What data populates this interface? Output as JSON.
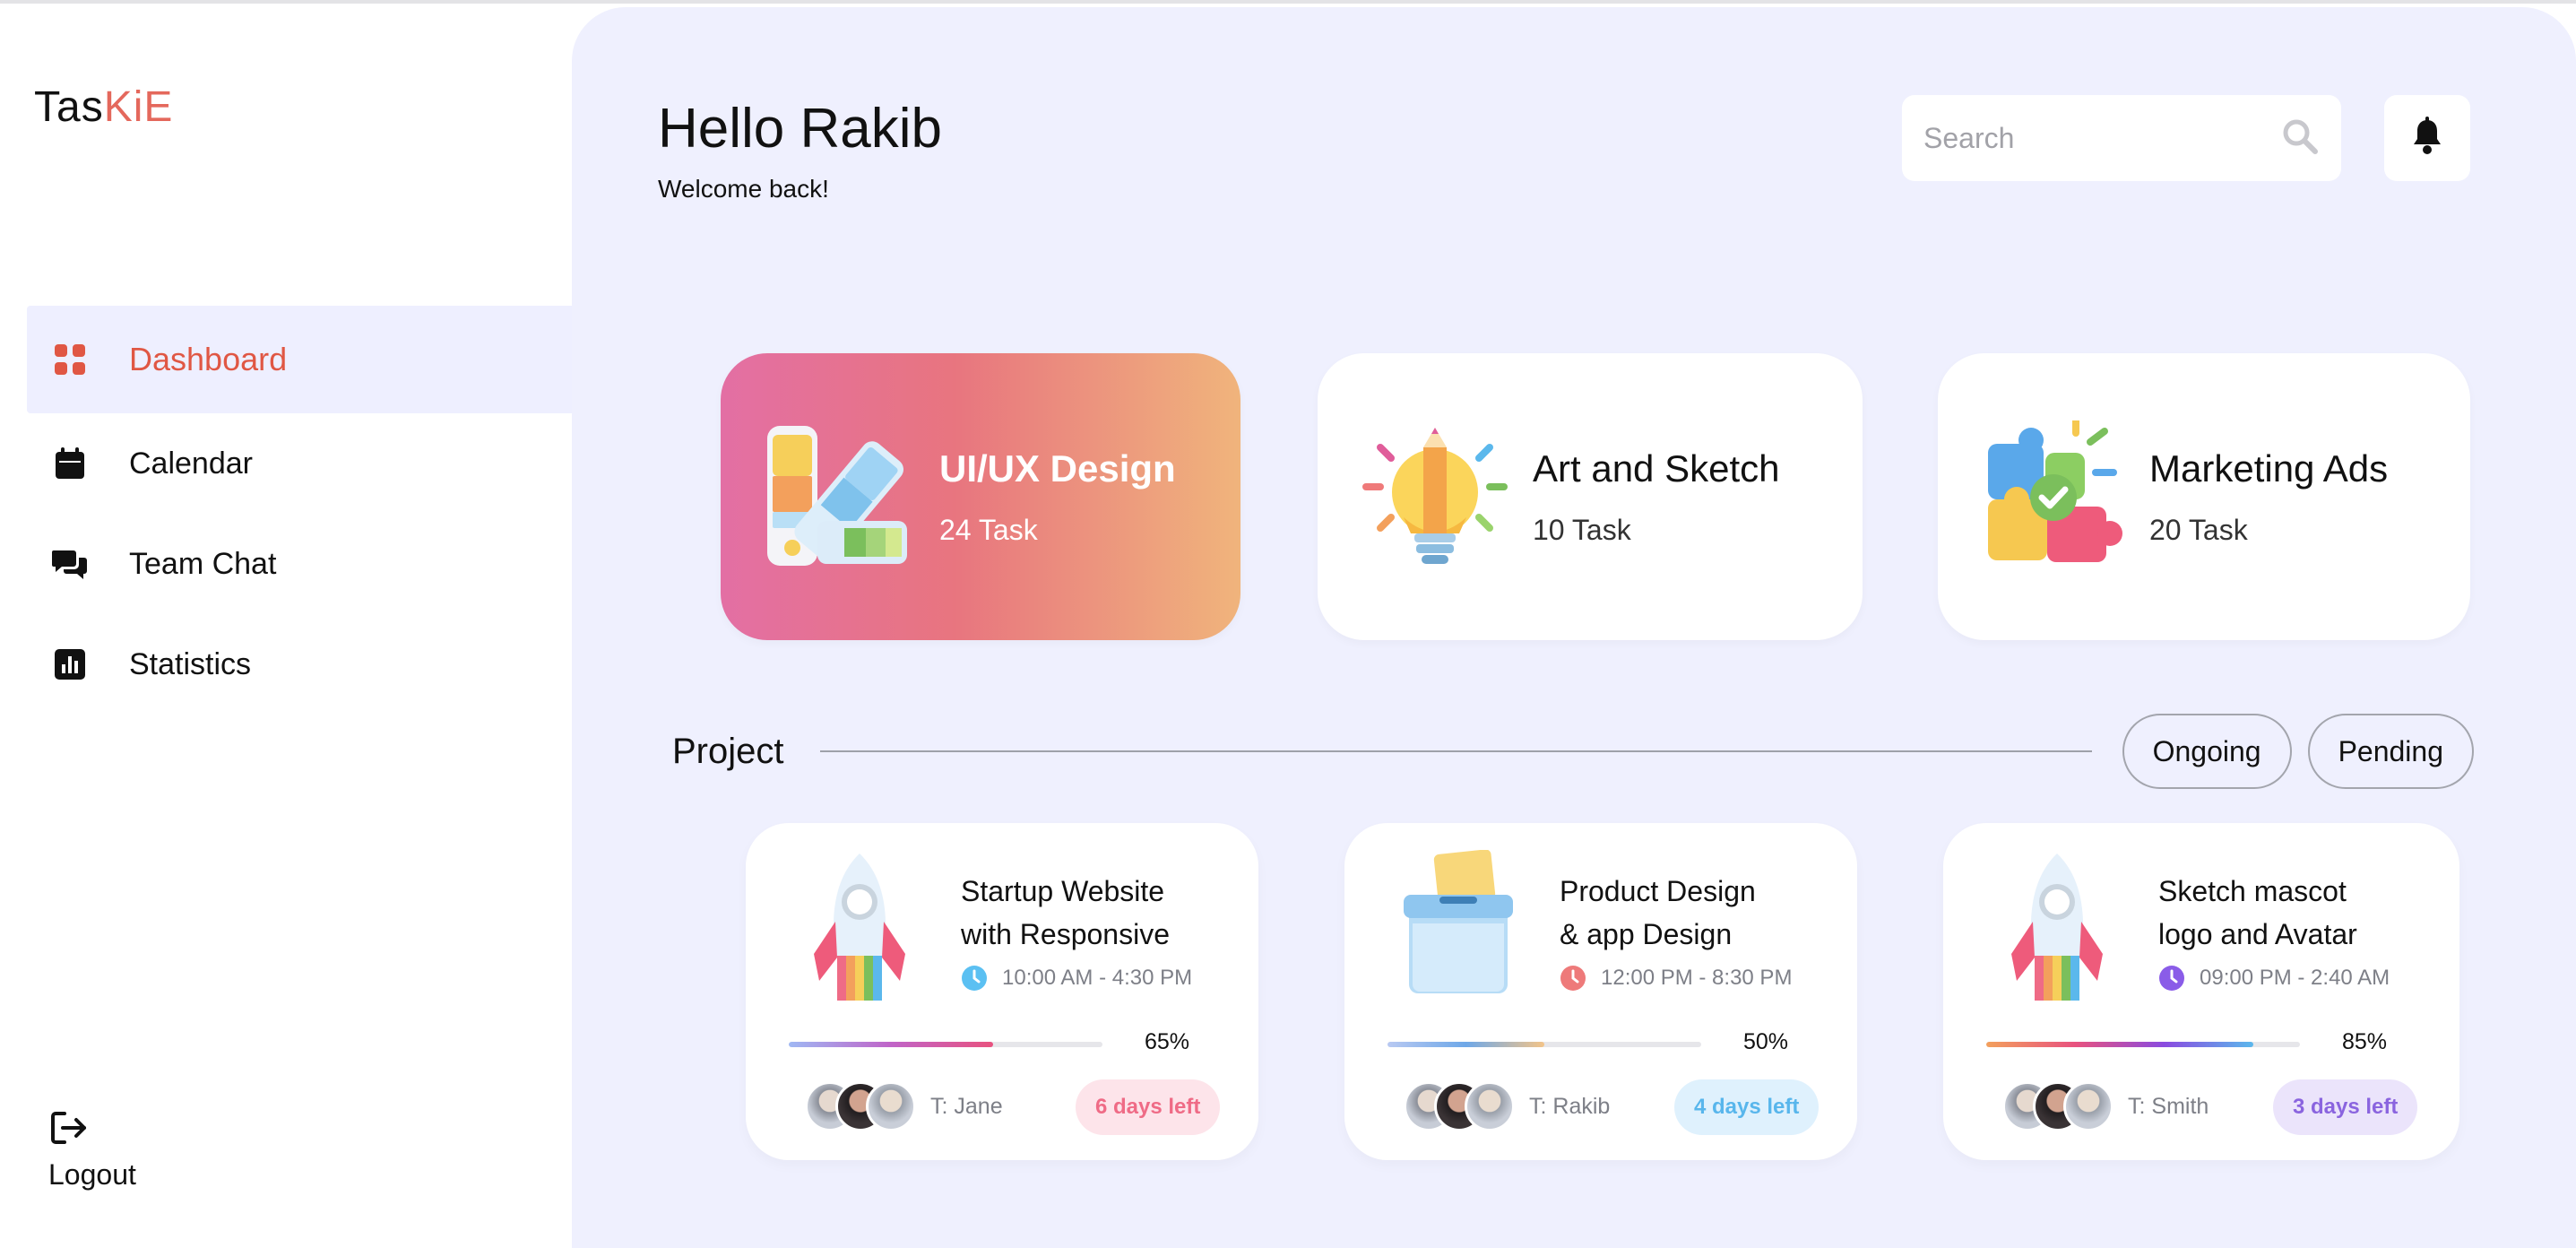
{
  "app": {
    "logo_part1": "Tas",
    "logo_part2": "KiE"
  },
  "sidebar": {
    "items": [
      {
        "label": "Dashboard",
        "icon": "grid-icon",
        "active": true
      },
      {
        "label": "Calendar",
        "icon": "calendar-icon"
      },
      {
        "label": "Team Chat",
        "icon": "chat-icon"
      },
      {
        "label": "Statistics",
        "icon": "chart-icon"
      }
    ],
    "logout_label": "Logout"
  },
  "header": {
    "greeting": "Hello Rakib",
    "subtitle": "Welcome back!",
    "search_placeholder": "Search"
  },
  "categories": [
    {
      "title": "UI/UX Design",
      "count": "24 Task",
      "icon": "color-swatch-icon",
      "active": true
    },
    {
      "title": "Art and Sketch",
      "count": "10 Task",
      "icon": "lightbulb-pencil-icon"
    },
    {
      "title": "Marketing Ads",
      "count": "20 Task",
      "icon": "puzzle-icon"
    }
  ],
  "projects_section": {
    "title": "Project",
    "filters": [
      "Ongoing",
      "Pending"
    ]
  },
  "projects": [
    {
      "title_line1": "Startup Website",
      "title_line2": "with Responsive",
      "time": "10:00 AM - 4:30 PM",
      "progress": 0.65,
      "progress_label": "65%",
      "team": "T: Jane",
      "due": "6 days left",
      "clock_color": "#5bc0f2",
      "due_bg": "#fde4ea",
      "due_color": "#ef6b86",
      "icon": "rocket-icon"
    },
    {
      "title_line1": "Product Design",
      "title_line2": "& app Design",
      "time": "12:00 PM - 8:30 PM",
      "progress": 0.5,
      "progress_label": "50%",
      "team": "T: Rakib",
      "due": "4 days left",
      "clock_color": "#ee7a7a",
      "due_bg": "#dff1fd",
      "due_color": "#58b6ec",
      "icon": "box-icon"
    },
    {
      "title_line1": "Sketch mascot",
      "title_line2": "logo and Avatar",
      "time": "09:00 PM - 2:40 AM",
      "progress": 0.85,
      "progress_label": "85%",
      "team": "T: Smith",
      "due": "3 days left",
      "clock_color": "#8a5ce8",
      "due_bg": "#ebe4fb",
      "due_color": "#8a64df",
      "icon": "rocket-icon"
    }
  ],
  "colors": {
    "accent": "#e4685c",
    "main_bg": "#eff0fe"
  }
}
